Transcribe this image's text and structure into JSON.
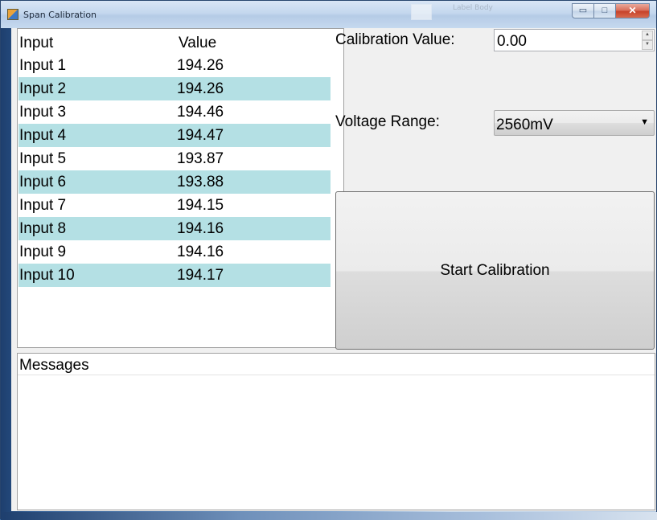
{
  "window": {
    "title": "Span Calibration",
    "background_ghost_text": "Label Body",
    "caption": {
      "minimize": "▭",
      "maximize": "□",
      "close": "✕"
    }
  },
  "inputs_list": {
    "columns": [
      "Input",
      "Value"
    ],
    "rows": [
      {
        "input": "Input 1",
        "value": "194.26"
      },
      {
        "input": "Input 2",
        "value": "194.26"
      },
      {
        "input": "Input 3",
        "value": "194.46"
      },
      {
        "input": "Input 4",
        "value": "194.47"
      },
      {
        "input": "Input 5",
        "value": "193.87"
      },
      {
        "input": "Input 6",
        "value": "193.88"
      },
      {
        "input": "Input 7",
        "value": "194.15"
      },
      {
        "input": "Input 8",
        "value": "194.16"
      },
      {
        "input": "Input 9",
        "value": "194.16"
      },
      {
        "input": "Input 10",
        "value": "194.17"
      }
    ],
    "alt_row_color": "#b4e0e4"
  },
  "calibration": {
    "value_label": "Calibration Value:",
    "value": "0.00",
    "voltage_label": "Voltage Range:",
    "voltage_value": "2560mV",
    "start_button": "Start Calibration"
  },
  "messages": {
    "header": "Messages"
  }
}
